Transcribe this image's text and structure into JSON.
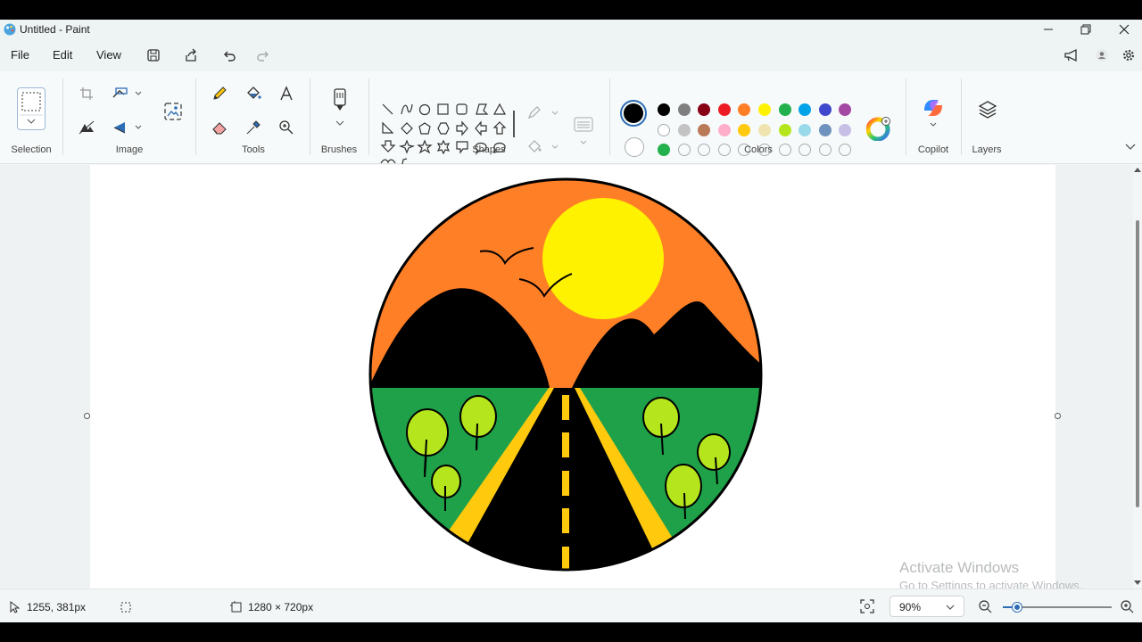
{
  "window": {
    "title": "Untitled - Paint",
    "minimize": "–",
    "restore": "❐",
    "close": "✕"
  },
  "menu": {
    "file": "File",
    "edit": "Edit",
    "view": "View"
  },
  "ribbon": {
    "groups": {
      "selection": "Selection",
      "image": "Image",
      "tools": "Tools",
      "brushes": "Brushes",
      "shapes": "Shapes",
      "colors": "Colors",
      "copilot": "Copilot",
      "layers": "Layers"
    },
    "colors": {
      "primary": "#000000",
      "secondary": "#ffffff",
      "row1": [
        "#000000",
        "#7f7f7f",
        "#880015",
        "#ed1c24",
        "#ff7f27",
        "#fff200",
        "#22b14c",
        "#00a2e8",
        "#3f48cc",
        "#a349a4"
      ],
      "row2": [
        "#ffffff",
        "#c3c3c3",
        "#b97a57",
        "#ffaec9",
        "#ffc90e",
        "#efe4b0",
        "#b5e61d",
        "#99d9ea",
        "#7092be",
        "#c8bfe7"
      ],
      "row3": [
        "#22b14c",
        "",
        "",
        "",
        "",
        "",
        "",
        "",
        "",
        ""
      ]
    }
  },
  "status": {
    "cursor": "1255, 381px",
    "canvas_size": "1280 × 720px",
    "zoom": "90%"
  },
  "watermark": {
    "line1": "Activate Windows",
    "line2": "Go to Settings to activate Windows."
  },
  "drawing": {
    "sky": "#ff7f27",
    "sun": "#fff200",
    "grass": "#1fa149",
    "mountains": "#000000",
    "road_edge": "#ffc90e",
    "trees": "#b5e61d"
  }
}
